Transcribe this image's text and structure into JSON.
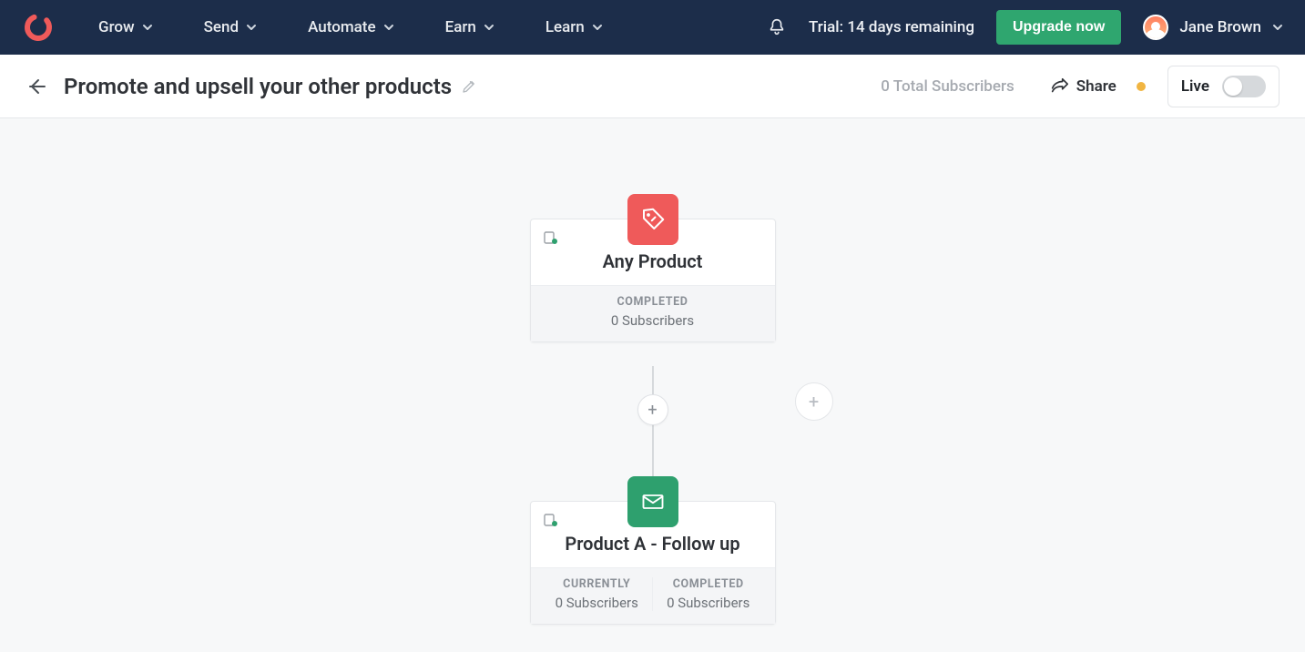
{
  "nav": {
    "items": [
      "Grow",
      "Send",
      "Automate",
      "Earn",
      "Learn"
    ],
    "trial_text": "Trial: 14 days remaining",
    "upgrade_label": "Upgrade now",
    "user_name": "Jane Brown"
  },
  "header": {
    "title": "Promote and upsell your other products",
    "total_subscribers": "0 Total Subscribers",
    "share_label": "Share",
    "live_label": "Live"
  },
  "nodes": {
    "trigger": {
      "title": "Any Product",
      "completed_label": "COMPLETED",
      "completed_value": "0 Subscribers"
    },
    "email": {
      "title": "Product A - Follow up",
      "currently_label": "CURRENTLY",
      "currently_value": "0 Subscribers",
      "completed_label": "COMPLETED",
      "completed_value": "0 Subscribers"
    }
  }
}
